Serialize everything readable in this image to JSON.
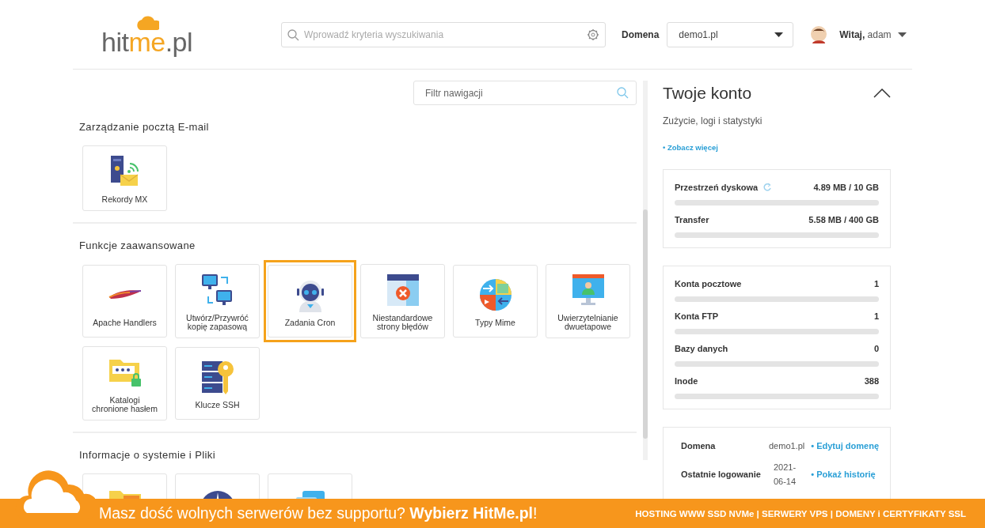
{
  "header": {
    "logo": [
      {
        "text": "hit",
        "accent": false
      },
      {
        "text": "me",
        "accent": true
      },
      {
        "text": ".pl",
        "accent": false
      }
    ],
    "search": {
      "placeholder": "Wprowadź kryteria wyszukiwania"
    },
    "domain_label": "Domena",
    "domain_select": "demo1.pl",
    "greeting": "**Witaj,** adam"
  },
  "navigation": {
    "filter": {
      "placeholder": "Filtr nawigacji"
    },
    "sections": [
      {
        "title": "Zarządzanie pocztą E-mail",
        "tiles": [
          {
            "label": "Rekordy MX",
            "kind": "mx",
            "selected": false
          }
        ]
      },
      {
        "title": "Funkcje zaawansowane",
        "tiles": [
          {
            "label": "Apache Handlers",
            "kind": "feather",
            "selected": false
          },
          {
            "label": "Utwórz/Przywróć kopię zapasową",
            "kind": "backup",
            "selected": false
          },
          {
            "label": "Zadania Cron",
            "kind": "robot",
            "selected": true
          },
          {
            "label": "Niestandardowe strony błędów",
            "kind": "error",
            "selected": false
          },
          {
            "label": "Typy Mime",
            "kind": "mime",
            "selected": false
          },
          {
            "label": "Uwierzytelnianie dwuetapowe",
            "kind": "twofa",
            "selected": false
          },
          {
            "label": "Katalogi chronione hasłem",
            "kind": "folderlock",
            "selected": false
          },
          {
            "label": "Klucze SSH",
            "kind": "keyserver",
            "selected": false
          }
        ]
      },
      {
        "title": "Informacje o systemie i Pliki",
        "tiles": [
          {
            "kind": "folder",
            "selected": false
          },
          {
            "kind": "compass",
            "selected": false
          },
          {
            "kind": "cloudfiles",
            "selected": false
          }
        ]
      }
    ]
  },
  "account": {
    "title": "Twoje konto",
    "subtitle": "Zużycie, logi i statystyki",
    "more_link": "• Zobacz więcej",
    "usage": [
      {
        "label": "Przestrzeń dyskowa",
        "reading": "4.89 MB / 10 GB",
        "level": 0,
        "refresh": true
      },
      {
        "label": "Transfer",
        "reading": "5.58 MB / 400 GB",
        "level": 0,
        "refresh": false
      }
    ],
    "counts": [
      {
        "label": "Konta pocztowe",
        "reading": "1",
        "level": 0
      },
      {
        "label": "Konta FTP",
        "reading": "1",
        "level": 0
      },
      {
        "label": "Bazy danych",
        "reading": "0",
        "level": 0
      },
      {
        "label": "Inode",
        "reading": "388",
        "level": 0
      }
    ],
    "details": [
      {
        "label": "Domena",
        "value": "demo1.pl",
        "link": "• Edytuj domenę"
      },
      {
        "label": "Ostatnie logowanie",
        "value": "2021-06-14",
        "link": "• Pokaż historię"
      }
    ]
  },
  "banner": {
    "message": "Masz dość wolnych serwerów bez supportu? **Wybierz HitMe.pl**!",
    "services": "HOSTING WWW SSD NVMe | SERWERY VPS | DOMENY i CERTYFIKATY SSL"
  }
}
